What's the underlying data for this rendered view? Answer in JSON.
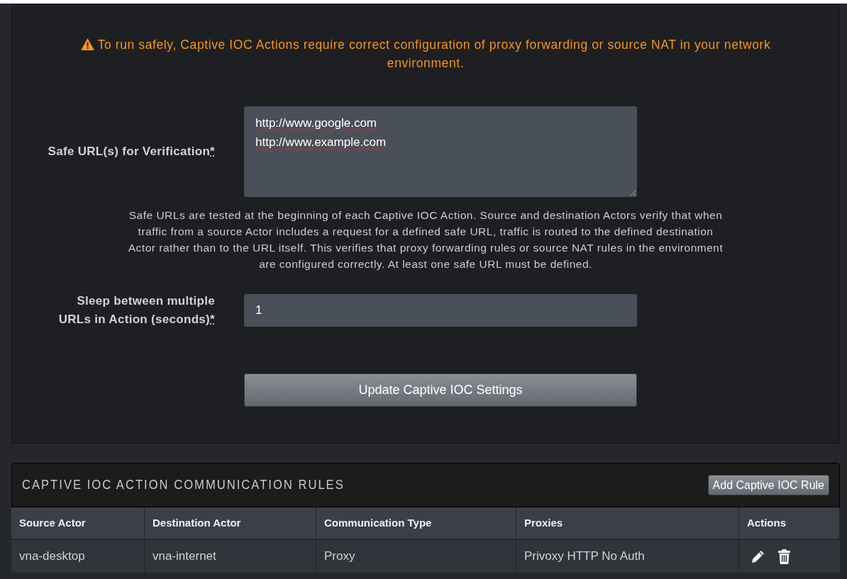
{
  "warning": {
    "text": "To run safely, Captive IOC Actions require correct configuration of proxy forwarding or source NAT in your network environment."
  },
  "fields": [
    {
      "kind": "textarea",
      "label": "Safe URL(s) for Verification",
      "required_mark": "*",
      "lines": [
        "http://www.google.com",
        "http://www.example.com"
      ],
      "help": "Safe URLs are tested at the beginning of each Captive IOC Action. Source and destination Actors verify that when traffic from a source Actor includes a request for a defined safe URL, traffic is routed to the defined destination Actor rather than to the URL itself. This verifies that proxy forwarding rules or source NAT rules in the environment are configured correctly. At least one safe URL must be defined."
    },
    {
      "kind": "input",
      "label": "Sleep between multiple URLs in Action (seconds)",
      "required_mark": "*",
      "value": "1"
    }
  ],
  "update_button": "Update Captive IOC Settings",
  "rules": {
    "title": "CAPTIVE IOC ACTION COMMUNICATION RULES",
    "add_button": "Add Captive IOC Rule",
    "columns": [
      "Source Actor",
      "Destination Actor",
      "Communication Type",
      "Proxies",
      "Actions"
    ],
    "rows": [
      {
        "cells": [
          "vna-desktop",
          "vna-internet",
          "Proxy",
          "Privoxy HTTP No Auth"
        ]
      }
    ]
  }
}
